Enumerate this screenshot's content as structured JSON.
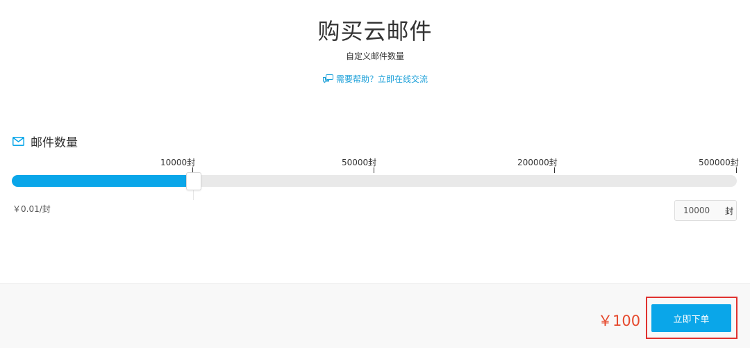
{
  "header": {
    "title": "购买云邮件",
    "subtitle": "自定义邮件数量",
    "help_link": "需要帮助？立即在线交流"
  },
  "section": {
    "label": "邮件数量",
    "icon": "mail-icon"
  },
  "slider": {
    "ticks": [
      "10000封",
      "50000封",
      "200000封",
      "500000封"
    ],
    "selected_value": 10000,
    "accent_color": "#0aa6e9",
    "track_color": "#e9e9e9"
  },
  "pricing": {
    "unit_price": "￥0.01/封",
    "quantity_value": "10000",
    "quantity_unit": "封",
    "total": "￥100",
    "total_color": "#e64a2e"
  },
  "footer": {
    "order_button": "立即下单"
  }
}
